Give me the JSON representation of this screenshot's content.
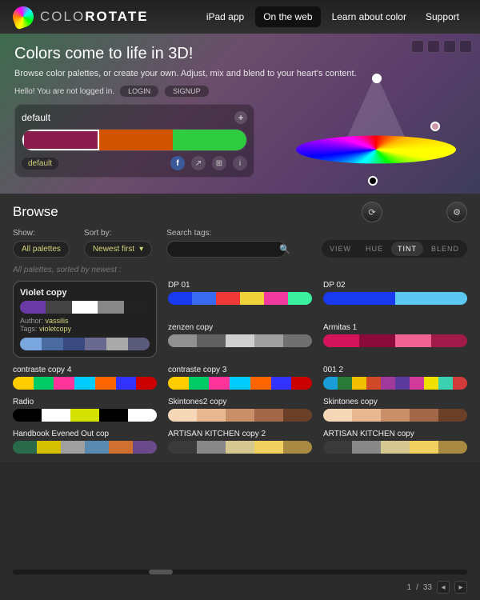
{
  "brand": {
    "thin": "COLO",
    "bold": "ROTATE"
  },
  "nav": [
    {
      "label": "iPad app",
      "active": false
    },
    {
      "label": "On the web",
      "active": true
    },
    {
      "label": "Learn about color",
      "active": false
    },
    {
      "label": "Support",
      "active": false
    }
  ],
  "hero": {
    "title": "Colors come to life in 3D!",
    "sub": "Browse color palettes, or create your own.\nAdjust, mix and blend to your heart's content.",
    "auth_msg": "Hello! You are not logged in.",
    "login": "LOGIN",
    "signup": "SIGNUP"
  },
  "current_palette": {
    "name": "default",
    "tag": "default",
    "colors": [
      "#8a1d4c",
      "#d35400",
      "#2ecc40"
    ],
    "selected": 0
  },
  "browse": {
    "heading": "Browse",
    "show_label": "Show:",
    "sort_label": "Sort by:",
    "search_label": "Search tags:",
    "show_value": "All palettes",
    "sort_value": "Newest first",
    "search_placeholder": "",
    "status": "All palettes, sorted by newest :",
    "modes": [
      "VIEW",
      "HUE",
      "TINT",
      "BLEND"
    ],
    "mode_active": 2
  },
  "featured": {
    "name": "Violet copy",
    "colors": [
      "#6a3aa6",
      "#444",
      "#fff",
      "#888",
      "#222"
    ],
    "author_label": "Author:",
    "author": "vassilis",
    "tags_label": "Tags:",
    "tag": "violetcopy",
    "extra_colors": [
      "#7aa6e0",
      "#4a6aa0",
      "#3a4a80",
      "#6a6a90",
      "#aaa",
      "#5a5a7a"
    ]
  },
  "palettes": [
    {
      "name": "DP 01",
      "colors": [
        "#1a3af0",
        "#3a6af0",
        "#f03a3a",
        "#f0d23a",
        "#f03aa0",
        "#3af0a0"
      ]
    },
    {
      "name": "DP 02",
      "colors": [
        "#1a3af0",
        "#5ac8f0"
      ]
    },
    {
      "name": "zenzen copy",
      "colors": [
        "#909090",
        "#606060",
        "#d0d0d0",
        "#a0a0a0",
        "#707070"
      ]
    },
    {
      "name": "Armitas 1",
      "colors": [
        "#d4145a",
        "#8a0a3a",
        "#f06292",
        "#a01a4a"
      ]
    },
    {
      "name": "contraste copy 4",
      "colors": [
        "#ffcc00",
        "#00cc66",
        "#ff3399",
        "#00ccff",
        "#ff6600",
        "#3333ff",
        "#cc0000"
      ]
    },
    {
      "name": "contraste copy 3",
      "colors": [
        "#ffcc00",
        "#00cc66",
        "#ff3399",
        "#00ccff",
        "#ff6600",
        "#3333ff",
        "#cc0000"
      ]
    },
    {
      "name": "001 2",
      "colors": [
        "#1a9dd9",
        "#2a7a3a",
        "#f0c000",
        "#d04a2a",
        "#a03a9a",
        "#5a3a9a",
        "#d23a9a",
        "#f0e000",
        "#3ad0b0",
        "#d03a3a"
      ]
    },
    {
      "name": "Radio",
      "colors": [
        "#000",
        "#fff",
        "#d4e000",
        "#000",
        "#fff"
      ]
    },
    {
      "name": "Skintones2 copy",
      "colors": [
        "#f5d7b8",
        "#e8b990",
        "#c89068",
        "#a06848",
        "#6a4028"
      ]
    },
    {
      "name": "Skintones copy",
      "colors": [
        "#f5d7b8",
        "#e8b990",
        "#c89068",
        "#a06848",
        "#6a4028"
      ]
    },
    {
      "name": "Handbook Evened Out cop",
      "colors": [
        "#2a6a4a",
        "#d4c000",
        "#a0a0a0",
        "#5a8ab0",
        "#d07030",
        "#6a4a8a"
      ]
    },
    {
      "name": "ARTISAN KITCHEN copy 2",
      "colors": [
        "#3a3a3a",
        "#888",
        "#d4c890",
        "#f0d060",
        "#a88a40"
      ]
    },
    {
      "name": "ARTISAN KITCHEN copy",
      "colors": [
        "#3a3a3a",
        "#888",
        "#d4c890",
        "#f0d060",
        "#a88a40"
      ]
    }
  ],
  "pager": {
    "current": "1",
    "sep": "/",
    "total": "33"
  }
}
